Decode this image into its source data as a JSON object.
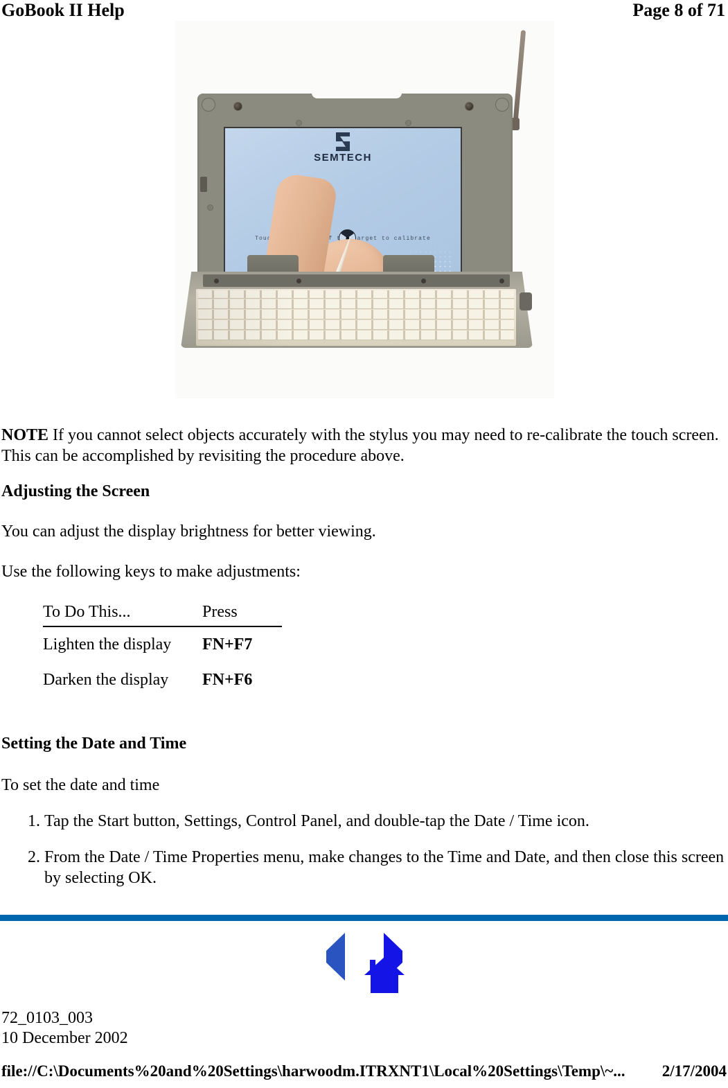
{
  "header": {
    "title": "GoBook II Help",
    "page_label": "Page 8 of 71"
  },
  "figure": {
    "alt_name": "gobook-touchscreen-calibration-photo",
    "screen": {
      "brand_mark": "semtech-logo-icon",
      "brand_text": "SEMTECH",
      "instruction": "Touch the center of the target to calibrate",
      "target_icon": "calibration-target-icon",
      "calibration_square": "calibration-square"
    },
    "stylus": "stylus",
    "antenna": "antenna"
  },
  "note": {
    "label": "NOTE",
    "text": "  If you cannot select objects accurately with the stylus you may need to re-calibrate the touch screen.   This can be accomplished by revisiting the procedure above."
  },
  "adjusting": {
    "heading": "Adjusting the Screen",
    "intro": "You can adjust the display brightness for better viewing.",
    "instruction": "Use the following keys to make adjustments:",
    "table": {
      "headers": [
        "To Do This...",
        "Press"
      ],
      "rows": [
        {
          "action": "Lighten  the display",
          "keys": "FN+F7"
        },
        {
          "action": "Darken the display",
          "keys": "FN+F6"
        }
      ]
    }
  },
  "datetime": {
    "heading": "Setting the Date and Time",
    "intro": "To set the date and time",
    "steps": [
      "Tap the Start button,  Settings, Control Panel, and double-tap the Date / Time icon.",
      "From the Date / Time Properties menu,  make changes to the Time and Date, and then close this screen by selecting OK."
    ]
  },
  "nav": {
    "back": "back-arrow",
    "home": "home-icon",
    "forward": "forward-arrow"
  },
  "doc": {
    "number": "72_0103_003",
    "date": "10 December 2002"
  },
  "browser_footer": {
    "path": "file://C:\\Documents%20and%20Settings\\harwoodm.ITRXNT1\\Local%20Settings\\Temp\\~...",
    "print_date": "2/17/2004"
  },
  "colors": {
    "rule": "#0066ae",
    "nav_blue": "#1414e6",
    "screen_blue": "#b3cbe5",
    "bezel": "#8b8b7f"
  }
}
